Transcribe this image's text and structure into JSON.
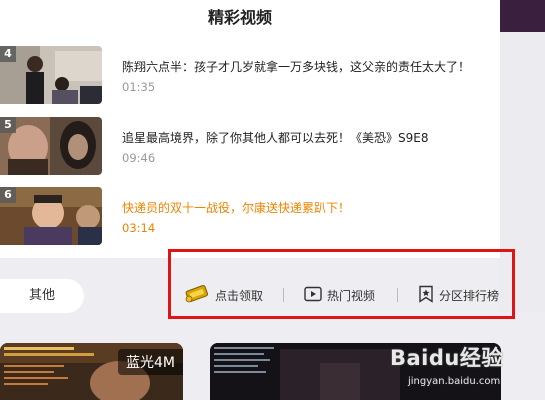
{
  "panel": {
    "title": "精彩视频"
  },
  "videos": [
    {
      "rank": "4",
      "title": "陈翔六点半：孩子才几岁就拿一万多块钱，这父亲的责任太大了！",
      "duration": "01:35",
      "active": false
    },
    {
      "rank": "5",
      "title": "追星最高境界，除了你其他人都可以去死！《美恐》S9E8",
      "duration": "09:46",
      "active": false
    },
    {
      "rank": "6",
      "title": "快递员的双十一战役，尔康送快递累趴下！",
      "duration": "03:14",
      "active": true
    }
  ],
  "filters": {
    "other_label": "其他"
  },
  "actions": {
    "claim_label": "点击领取",
    "hot_label": "热门视频",
    "rank_label": "分区排行榜"
  },
  "cards": [
    {
      "badge": "蓝光4M"
    },
    {
      "badge": ""
    }
  ],
  "watermark": {
    "main": "Baidu经验",
    "sub": "jingyan.baidu.com"
  },
  "colors": {
    "accent": "#f08300",
    "highlight_border": "#e01414",
    "topbar": "#3a1f3f"
  },
  "icons": {
    "claim": "gold-ticket-icon",
    "hot": "play-box-icon",
    "rank": "bookmark-star-icon"
  }
}
